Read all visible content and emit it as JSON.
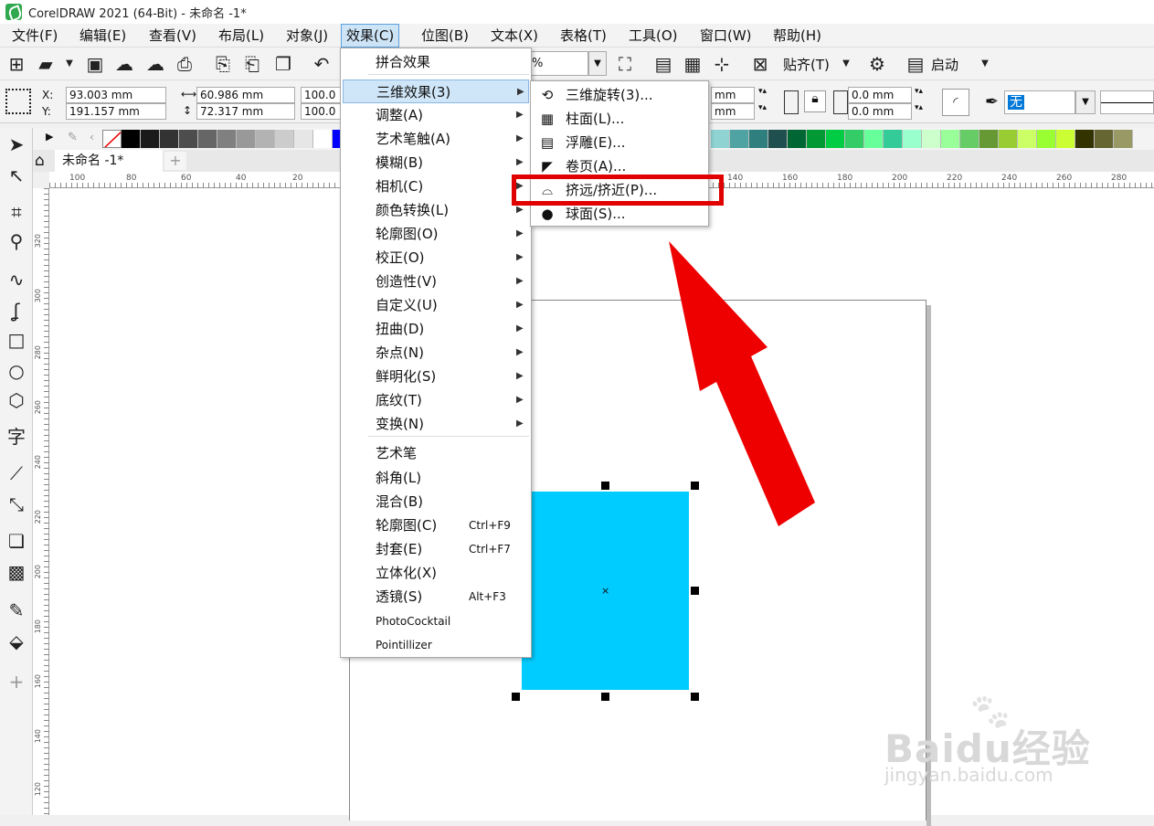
{
  "window": {
    "title": "CorelDRAW 2021 (64-Bit) - 未命名 -1*"
  },
  "menubar": [
    "文件(F)",
    "编辑(E)",
    "查看(V)",
    "布局(L)",
    "对象(J)",
    "效果(C)",
    "位图(B)",
    "文本(X)",
    "表格(T)",
    "工具(O)",
    "窗口(W)",
    "帮助(H)"
  ],
  "toolbar": {
    "zoom": "%",
    "snap_label": "贴齐(T)",
    "launch_label": "启动"
  },
  "propbar": {
    "x_label": "X:",
    "y_label": "Y:",
    "x_value": "93.003 mm",
    "y_value": "191.157 mm",
    "w_value": "60.986 mm",
    "h_value": "72.317 mm",
    "sx_value": "100.0",
    "sy_value": "100.0",
    "r1": "mm",
    "r2": "mm",
    "c1": "0.0 mm",
    "c2": "0.0 mm",
    "fill": "无"
  },
  "doc_tab": "未命名 -1*",
  "rulers": {
    "h": [
      "100",
      "80",
      "60",
      "40",
      "20",
      "140",
      "160",
      "180",
      "200",
      "220",
      "240",
      "260",
      "280"
    ],
    "v": [
      "320",
      "300",
      "280",
      "260",
      "240",
      "220",
      "200",
      "180",
      "160",
      "140",
      "120"
    ]
  },
  "effects_menu": {
    "items": [
      {
        "label": "拼合效果"
      },
      {
        "label": "三维效果(3)",
        "sub": true
      },
      {
        "label": "调整(A)",
        "sub": true
      },
      {
        "label": "艺术笔触(A)",
        "sub": true
      },
      {
        "label": "模糊(B)",
        "sub": true
      },
      {
        "label": "相机(C)",
        "sub": true
      },
      {
        "label": "颜色转换(L)",
        "sub": true
      },
      {
        "label": "轮廓图(O)",
        "sub": true
      },
      {
        "label": "校正(O)",
        "sub": true
      },
      {
        "label": "创造性(V)",
        "sub": true
      },
      {
        "label": "自定义(U)",
        "sub": true
      },
      {
        "label": "扭曲(D)",
        "sub": true
      },
      {
        "label": "杂点(N)",
        "sub": true
      },
      {
        "label": "鲜明化(S)",
        "sub": true
      },
      {
        "label": "底纹(T)",
        "sub": true
      },
      {
        "label": "变换(N)",
        "sub": true
      },
      {
        "label": "艺术笔"
      },
      {
        "label": "斜角(L)"
      },
      {
        "label": "混合(B)"
      },
      {
        "label": "轮廓图(C)",
        "shortcut": "Ctrl+F9"
      },
      {
        "label": "封套(E)",
        "shortcut": "Ctrl+F7"
      },
      {
        "label": "立体化(X)"
      },
      {
        "label": "透镜(S)",
        "shortcut": "Alt+F3"
      },
      {
        "label": "PhotoCocktail"
      },
      {
        "label": "Pointillizer"
      }
    ]
  },
  "submenu_3d": {
    "items": [
      {
        "label": "三维旋转(3)...",
        "icon": "cube-rotate-icon"
      },
      {
        "label": "柱面(L)...",
        "icon": "cylinder-icon"
      },
      {
        "label": "浮雕(E)...",
        "icon": "emboss-icon"
      },
      {
        "label": "卷页(A)...",
        "icon": "page-curl-icon"
      },
      {
        "label": "挤远/挤近(P)...",
        "icon": "pinch-punch-icon"
      },
      {
        "label": "球面(S)...",
        "icon": "sphere-icon"
      }
    ]
  },
  "palette": [
    "#000000",
    "#1a1a1a",
    "#333333",
    "#4d4d4d",
    "#666666",
    "#808080",
    "#999999",
    "#b3b3b3",
    "#cccccc",
    "#e6e6e6",
    "#ffffff",
    "#0000ff",
    "#8fd3d3",
    "#4fa3a3",
    "#2f7f7f",
    "#1f4f4f",
    "#006633",
    "#009933",
    "#00cc44",
    "#33cc66",
    "#66ff99",
    "#33cc99",
    "#99ffcc",
    "#ccffcc",
    "#99ff99",
    "#66cc66",
    "#669933",
    "#99cc33",
    "#ccff66",
    "#99ff33",
    "#ccff33",
    "#333300",
    "#666633",
    "#999966"
  ],
  "watermark": {
    "brand": "Baidu经验",
    "url": "jingyan.baidu.com"
  },
  "colors": {
    "rect_fill": "#00ccff",
    "highlight": "#e00000",
    "arrow": "#ee0000"
  }
}
